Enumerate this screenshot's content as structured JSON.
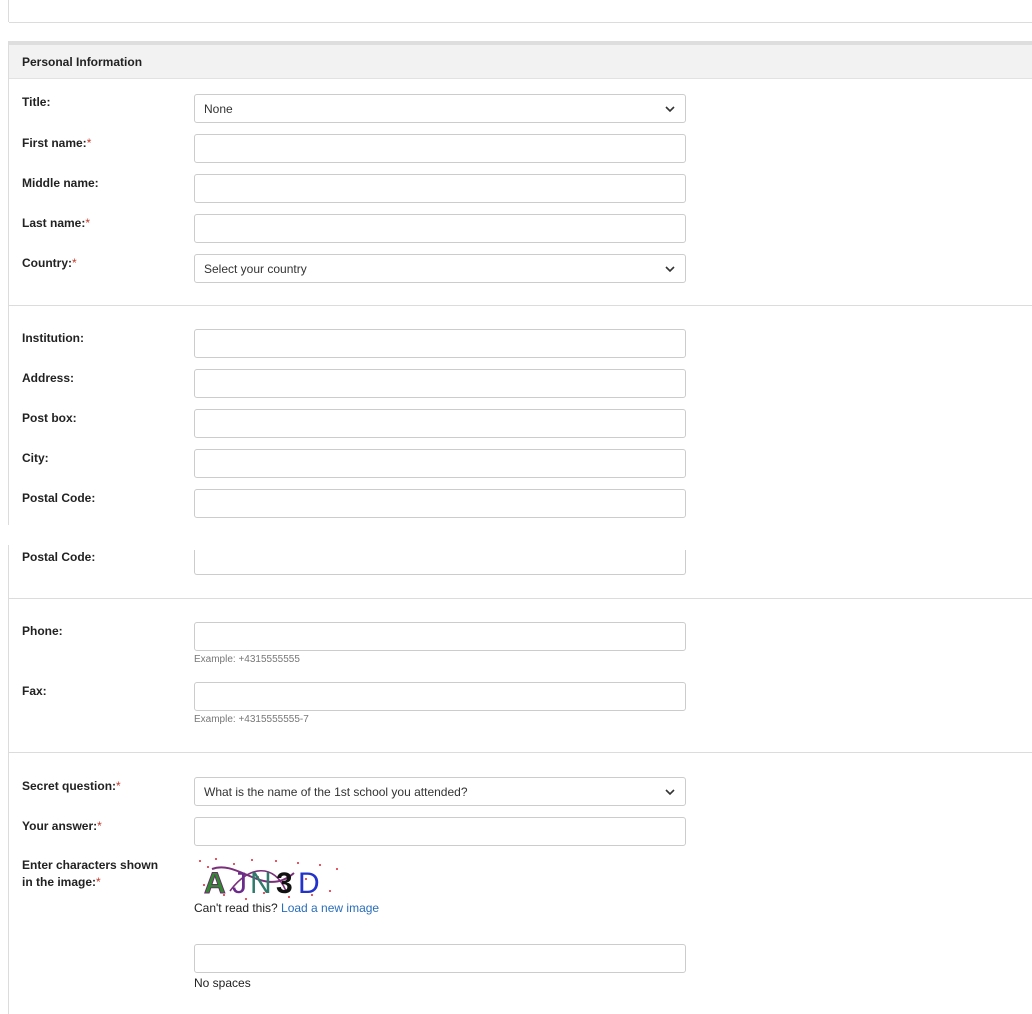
{
  "section": {
    "title": "Personal Information"
  },
  "required_marker": "*",
  "fields": {
    "title": {
      "label": "Title:",
      "value": "None"
    },
    "first_name": {
      "label": "First name:",
      "value": ""
    },
    "middle_name": {
      "label": "Middle name:",
      "value": ""
    },
    "last_name": {
      "label": "Last name:",
      "value": ""
    },
    "country": {
      "label": "Country:",
      "value": "Select your country"
    },
    "institution": {
      "label": "Institution:",
      "value": ""
    },
    "address": {
      "label": "Address:",
      "value": ""
    },
    "post_box": {
      "label": "Post box:",
      "value": ""
    },
    "city": {
      "label": "City:",
      "value": ""
    },
    "postal_code": {
      "label": "Postal Code:",
      "value": ""
    },
    "postal_code_repeat": {
      "label": "Postal Code:"
    },
    "phone": {
      "label": "Phone:",
      "value": "",
      "hint": "Example: +4315555555"
    },
    "fax": {
      "label": "Fax:",
      "value": "",
      "hint": "Example: +4315555555-7"
    },
    "secret_question": {
      "label": "Secret question:",
      "value": "What is the name of the 1st school you attended?"
    },
    "your_answer": {
      "label": "Your answer:",
      "value": ""
    },
    "captcha": {
      "label_line1": "Enter characters shown",
      "label_line2": "in the image:",
      "image_text": "AJN3D",
      "cant_read": "Can't read this?",
      "reload_link": "Load a new image",
      "input_value": "",
      "hint": "No spaces"
    }
  },
  "colors": {
    "required": "#c0392b",
    "link": "#2a6ebb",
    "header_bg": "#f2f2f2"
  },
  "icons": {
    "select_arrow": "chevron-down-icon"
  }
}
